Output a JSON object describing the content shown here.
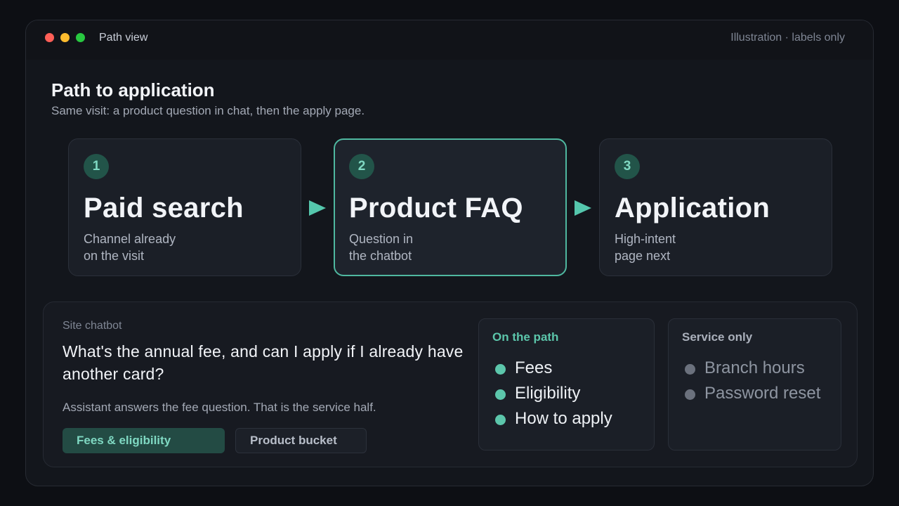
{
  "window": {
    "title": "Path view",
    "meta": "Illustration · labels only"
  },
  "page": {
    "title": "Path to application",
    "subtitle": "Same visit: a product question in chat, then the apply page."
  },
  "steps": [
    {
      "number": "1",
      "title": "Paid search",
      "desc_line1": "Channel already",
      "desc_line2": "on the visit"
    },
    {
      "number": "2",
      "title": "Product FAQ",
      "desc_line1": "Question in",
      "desc_line2": "the chatbot"
    },
    {
      "number": "3",
      "title": "Application",
      "desc_line1": "High-intent",
      "desc_line2": "page next"
    }
  ],
  "chatbot": {
    "label": "Site chatbot",
    "question": "What's the annual fee, and can I apply if I already have another card?",
    "note": "Assistant answers the fee question. That is the service half.",
    "tags": [
      "Fees & eligibility",
      "Product bucket"
    ]
  },
  "on_path": {
    "title": "On the path",
    "items": [
      "Fees",
      "Eligibility",
      "How to apply"
    ]
  },
  "service_only": {
    "title": "Service only",
    "items": [
      "Branch hours",
      "Password reset"
    ]
  },
  "colors": {
    "accent": "#4fb8a0",
    "background": "#0d0f14",
    "card": "#1b1f27"
  }
}
